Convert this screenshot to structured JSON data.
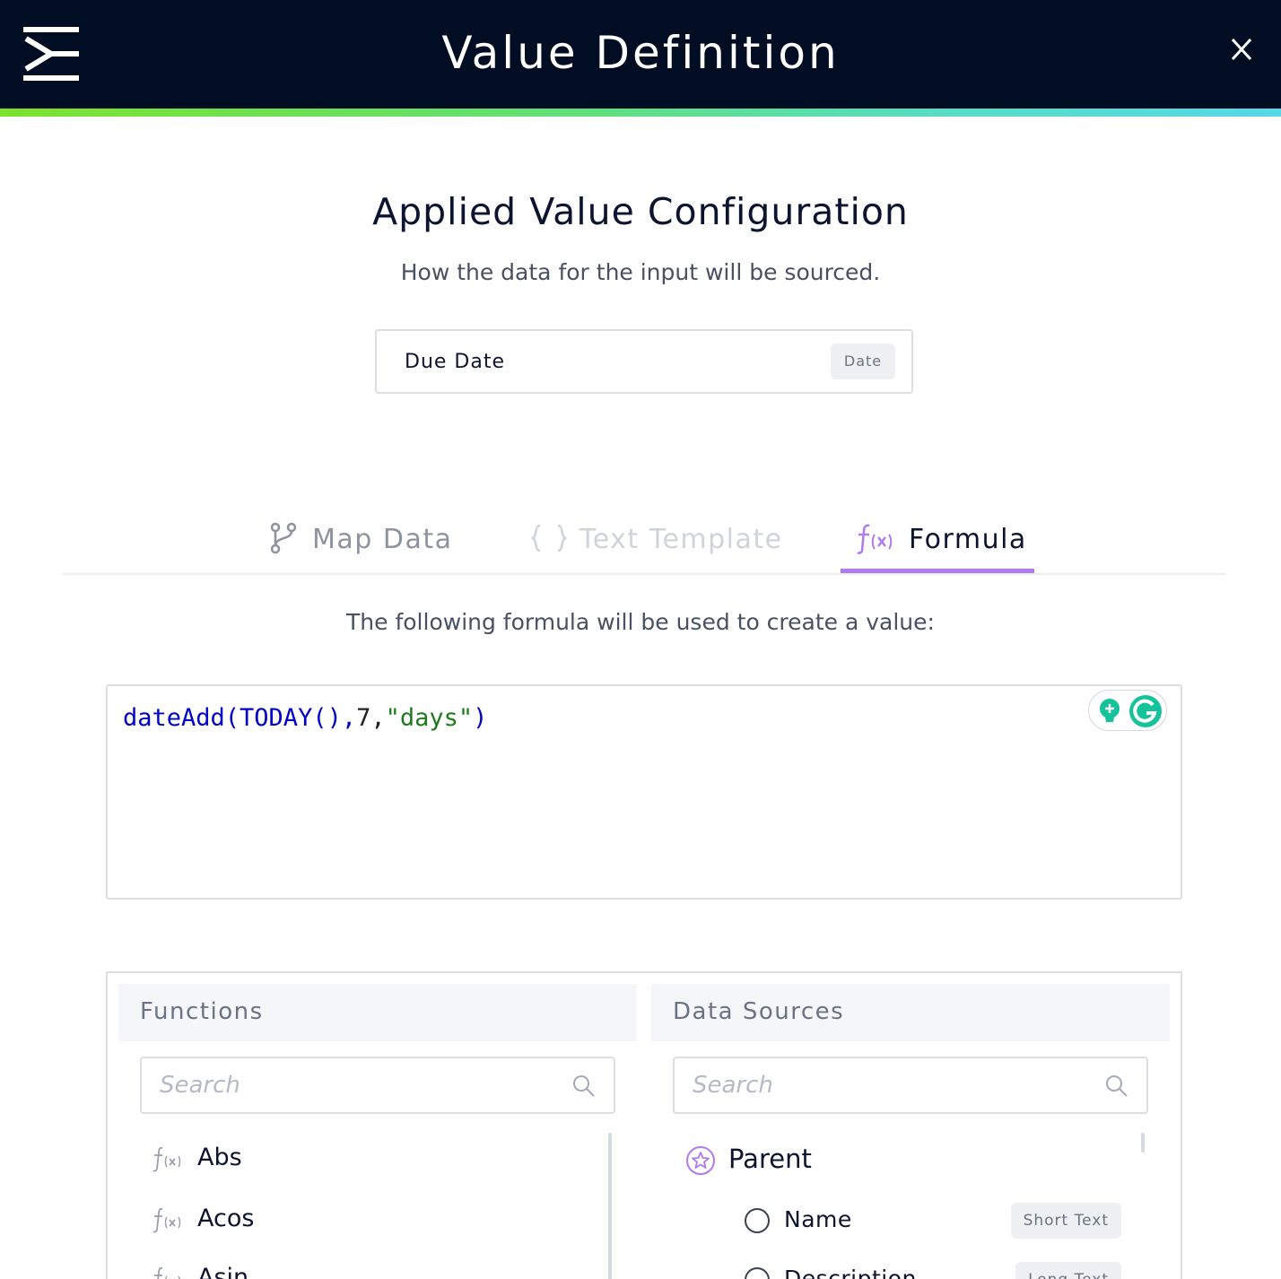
{
  "header": {
    "title": "Value Definition",
    "gradient_colors": [
      "#7be22c",
      "#56d8e6"
    ],
    "background": "#010d22"
  },
  "config": {
    "title": "Applied Value Configuration",
    "subtitle": "How the data for the input will be sourced.",
    "field_name": "Due Date",
    "field_type": "Date"
  },
  "tabs": [
    {
      "label": "Map Data",
      "icon": "branch-icon",
      "state": "inactive"
    },
    {
      "label": "Text Template",
      "icon": "curly-braces-icon",
      "state": "disabled"
    },
    {
      "label": "Formula",
      "icon": "function-icon",
      "state": "active"
    }
  ],
  "accent_color": "#b07bf0",
  "formula": {
    "intro": "The following formula will be used to create a value:",
    "tokens": {
      "fn_open": "dateAdd(TODAY(),",
      "num": "7,",
      "str": "\"days\"",
      "close": ")"
    }
  },
  "functions": {
    "title": "Functions",
    "search_placeholder": "Search",
    "items": [
      "Abs",
      "Acos",
      "Asin"
    ]
  },
  "data_sources": {
    "title": "Data Sources",
    "search_placeholder": "Search",
    "parent": "Parent",
    "items": [
      {
        "name": "Name",
        "type": "Short Text"
      },
      {
        "name": "Description",
        "type": "Long Text"
      }
    ]
  }
}
